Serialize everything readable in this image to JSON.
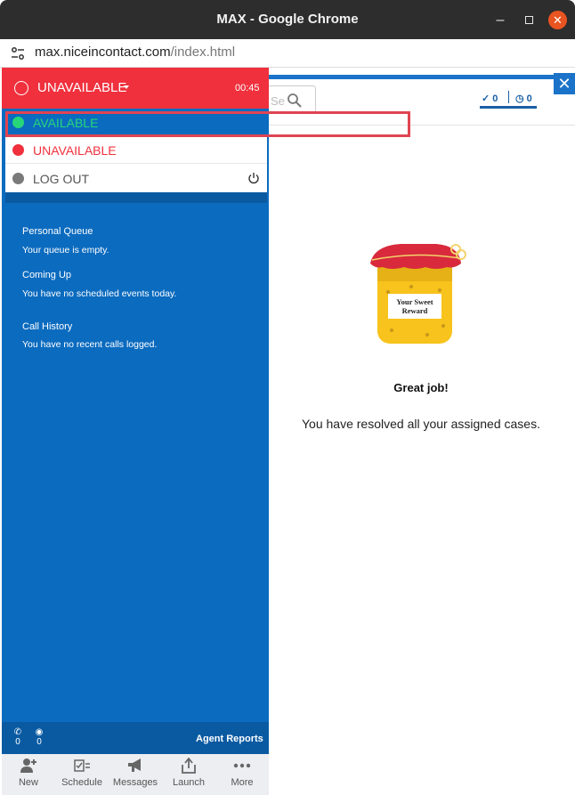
{
  "window": {
    "title": "MAX - Google Chrome",
    "url_host": "max.niceincontact.com",
    "url_path": "/index.html"
  },
  "status": {
    "current": "UNAVAILABLE",
    "timer": "00:45",
    "menu": [
      {
        "label": "AVAILABLE",
        "color": "#28d67a"
      },
      {
        "label": "UNAVAILABLE",
        "color": "#f0303d"
      },
      {
        "label": "LOG OUT",
        "color": "#7a7a7a"
      }
    ]
  },
  "search": {
    "placeholder": "Se"
  },
  "counters": {
    "checked": "0",
    "scheduled": "0"
  },
  "sidebar": {
    "sections": [
      {
        "title": "Personal Queue",
        "text": "Your queue is empty."
      },
      {
        "title": "Coming Up",
        "text": "You have no scheduled events today."
      },
      {
        "title": "Call History",
        "text": "You have no recent calls logged."
      }
    ],
    "calls_count": "0",
    "chats_count": "0",
    "agent_reports": "Agent Reports"
  },
  "nav": [
    {
      "label": "New",
      "icon": "add-user-icon"
    },
    {
      "label": "Schedule",
      "icon": "schedule-icon"
    },
    {
      "label": "Messages",
      "icon": "megaphone-icon"
    },
    {
      "label": "Launch",
      "icon": "launch-icon"
    },
    {
      "label": "More",
      "icon": "more-icon"
    }
  ],
  "empty_state": {
    "jar_label_line1": "Your Sweet",
    "jar_label_line2": "Reward",
    "heading": "Great job!",
    "message": "You have resolved all your assigned cases."
  },
  "colors": {
    "brand_blue": "#0b6bbf",
    "unavailable_red": "#f0303d",
    "available_green": "#28d67a"
  }
}
